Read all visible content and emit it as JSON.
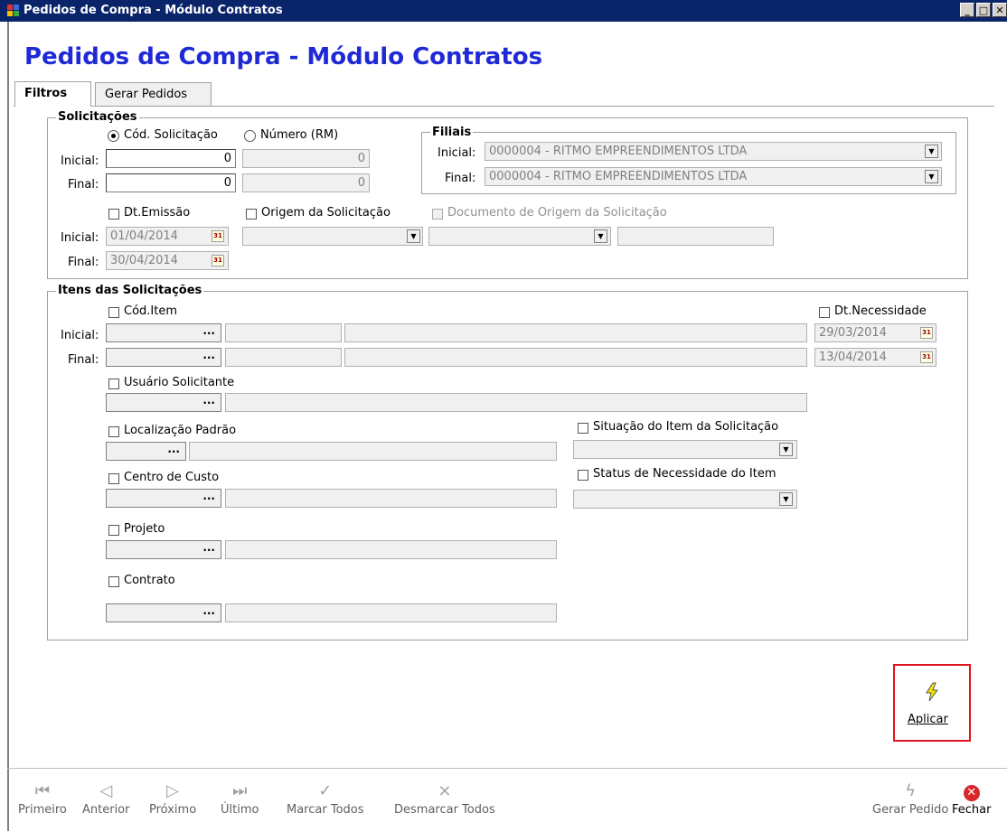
{
  "window": {
    "title": "Pedidos de Compra - Módulo Contratos",
    "buttons": [
      "_",
      "□",
      "X"
    ]
  },
  "heading": "Pedidos de Compra - Módulo Contratos",
  "tabs": [
    {
      "label": "Filtros",
      "active": true
    },
    {
      "label": "Gerar Pedidos",
      "active": false
    }
  ],
  "solicitacoes": {
    "legend": "Solicitações",
    "radio_cod": "Cód. Solicitação",
    "radio_num": "Número (RM)",
    "inicial_label": "Inicial:",
    "final_label": "Final:",
    "cod_inicial": "0",
    "cod_final": "0",
    "num_inicial": "0",
    "num_final": "0",
    "dt_emissao_label": "Dt.Emissão",
    "dt_inicial": "01/04/2014",
    "dt_final": "30/04/2014",
    "origem_label": "Origem da Solicitação",
    "documento_label": "Documento de Origem da Solicitação"
  },
  "filiais": {
    "legend": "Filiais",
    "inicial_label": "Inicial:",
    "final_label": "Final:",
    "inicial": "0000004 - RITMO EMPREENDIMENTOS LTDA",
    "final": "0000004 - RITMO EMPREENDIMENTOS LTDA"
  },
  "itens": {
    "legend": "Itens das Solicitações",
    "cod_item_label": "Cód.Item",
    "inicial_label": "Inicial:",
    "final_label": "Final:",
    "dt_necessidade_label": "Dt.Necessidade",
    "dt_nec_inicial": "29/03/2014",
    "dt_nec_final": "13/04/2014",
    "usuario_label": "Usuário Solicitante",
    "localizacao_label": "Localização Padrão",
    "centro_custo_label": "Centro de Custo",
    "projeto_label": "Projeto",
    "contrato_label": "Contrato",
    "situacao_label": "Situação do Item da Solicitação",
    "status_label": "Status de Necessidade do Item",
    "ellipsis": "..."
  },
  "aplicar": {
    "label": "Aplicar"
  },
  "toolbar": {
    "primeiro": "Primeiro",
    "anterior": "Anterior",
    "proximo": "Próximo",
    "ultimo": "Último",
    "marcar_todos": "Marcar Todos",
    "desmarcar_todos": "Desmarcar Todos",
    "gerar_pedido": "Gerar Pedido",
    "fechar": "Fechar"
  },
  "icons": {
    "first": "first-record-icon",
    "prev": "previous-record-icon",
    "next": "next-record-icon",
    "last": "last-record-icon",
    "check_all": "check-all-icon",
    "uncheck_all": "uncheck-all-icon",
    "generate": "lightning-icon",
    "close": "close-icon"
  },
  "colors": {
    "title_bar": "#0a246a",
    "heading": "#1f29d6",
    "highlight_border": "#e0161e",
    "close_red": "#d9262b",
    "lightning_yellow": "#f5e400"
  }
}
